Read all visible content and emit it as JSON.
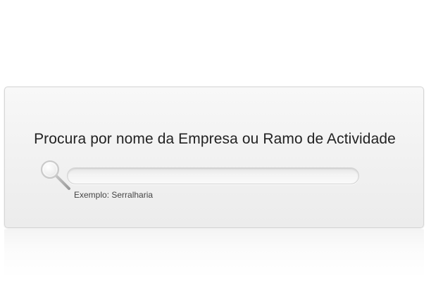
{
  "search": {
    "title": "Procura por nome da Empresa ou Ramo de Actividade",
    "input_value": "",
    "hint": "Exemplo: Serralharia",
    "icon": "magnifier-icon"
  },
  "colors": {
    "panel_background": "#f2f2f2",
    "panel_border": "#d6d6d6",
    "title_text": "#222222",
    "hint_text": "#444444",
    "input_border": "#d2d2d2"
  }
}
